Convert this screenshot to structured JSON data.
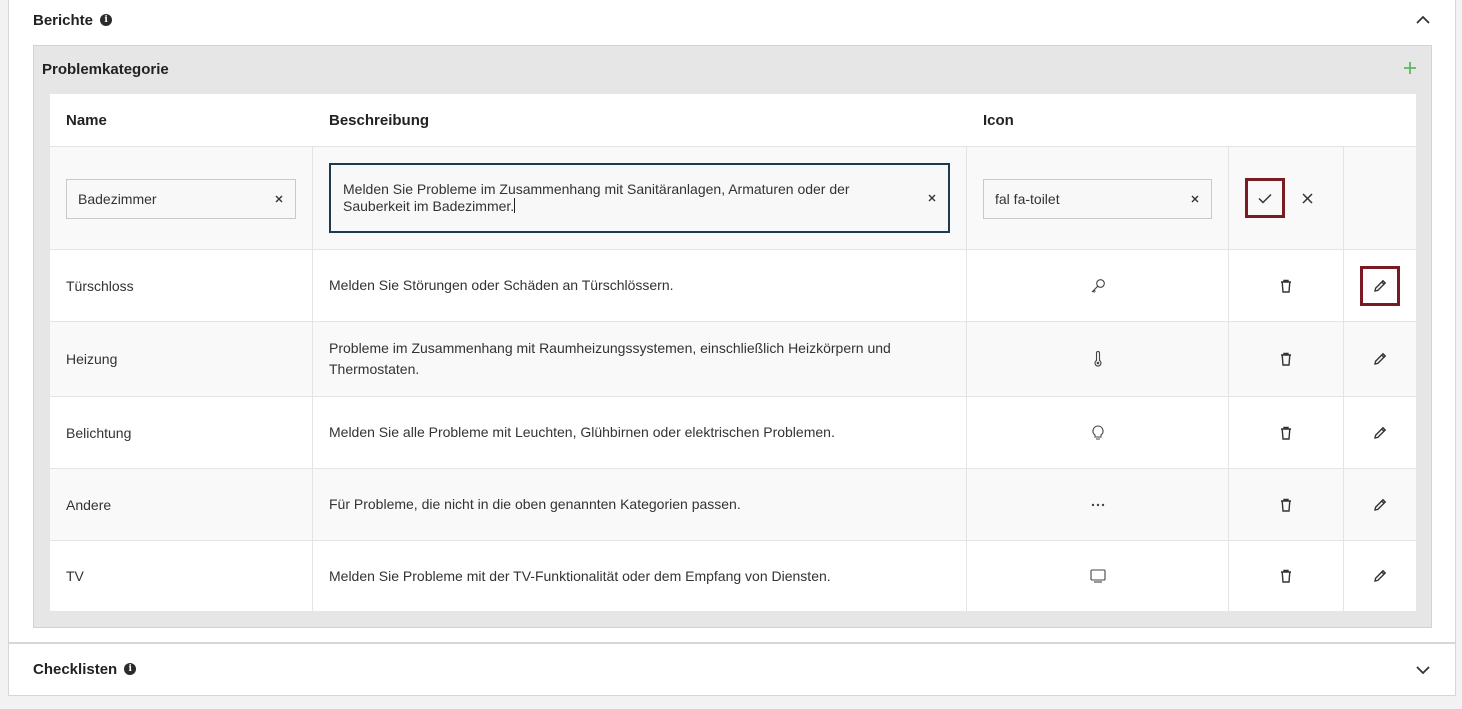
{
  "sections": {
    "reports": {
      "title": "Berichte",
      "info_icon": "i"
    },
    "checklists": {
      "title": "Checklisten",
      "info_icon": "i"
    }
  },
  "category_panel": {
    "title": "Problemkategorie"
  },
  "table": {
    "headers": {
      "name": "Name",
      "description": "Beschreibung",
      "icon": "Icon"
    },
    "edit_row": {
      "name_value": "Badezimmer",
      "description_value": "Melden Sie Probleme im Zusammenhang mit Sanitäranlagen, Armaturen oder der Sauberkeit im Badezimmer.",
      "icon_value": "fal fa-toilet"
    },
    "rows": [
      {
        "name": "Türschloss",
        "description": "Melden Sie Störungen oder Schäden an Türschlössern.",
        "icon": "key-icon"
      },
      {
        "name": "Heizung",
        "description": "Probleme im Zusammenhang mit Raumheizungssystemen, einschließlich Heizkörpern und Thermostaten.",
        "icon": "thermometer-icon"
      },
      {
        "name": "Belichtung",
        "description": "Melden Sie alle Probleme mit Leuchten, Glühbirnen oder elektrischen Problemen.",
        "icon": "lightbulb-icon"
      },
      {
        "name": "Andere",
        "description": "Für Probleme, die nicht in die oben genannten Kategorien passen.",
        "icon": "ellipsis-icon"
      },
      {
        "name": "TV",
        "description": "Melden Sie Probleme mit der TV-Funktionalität oder dem Empfang von Diensten.",
        "icon": "tv-icon"
      }
    ]
  },
  "colors": {
    "highlight": "#7b1a22",
    "add": "#5cb85c",
    "focus_border": "#1f3a4d"
  }
}
